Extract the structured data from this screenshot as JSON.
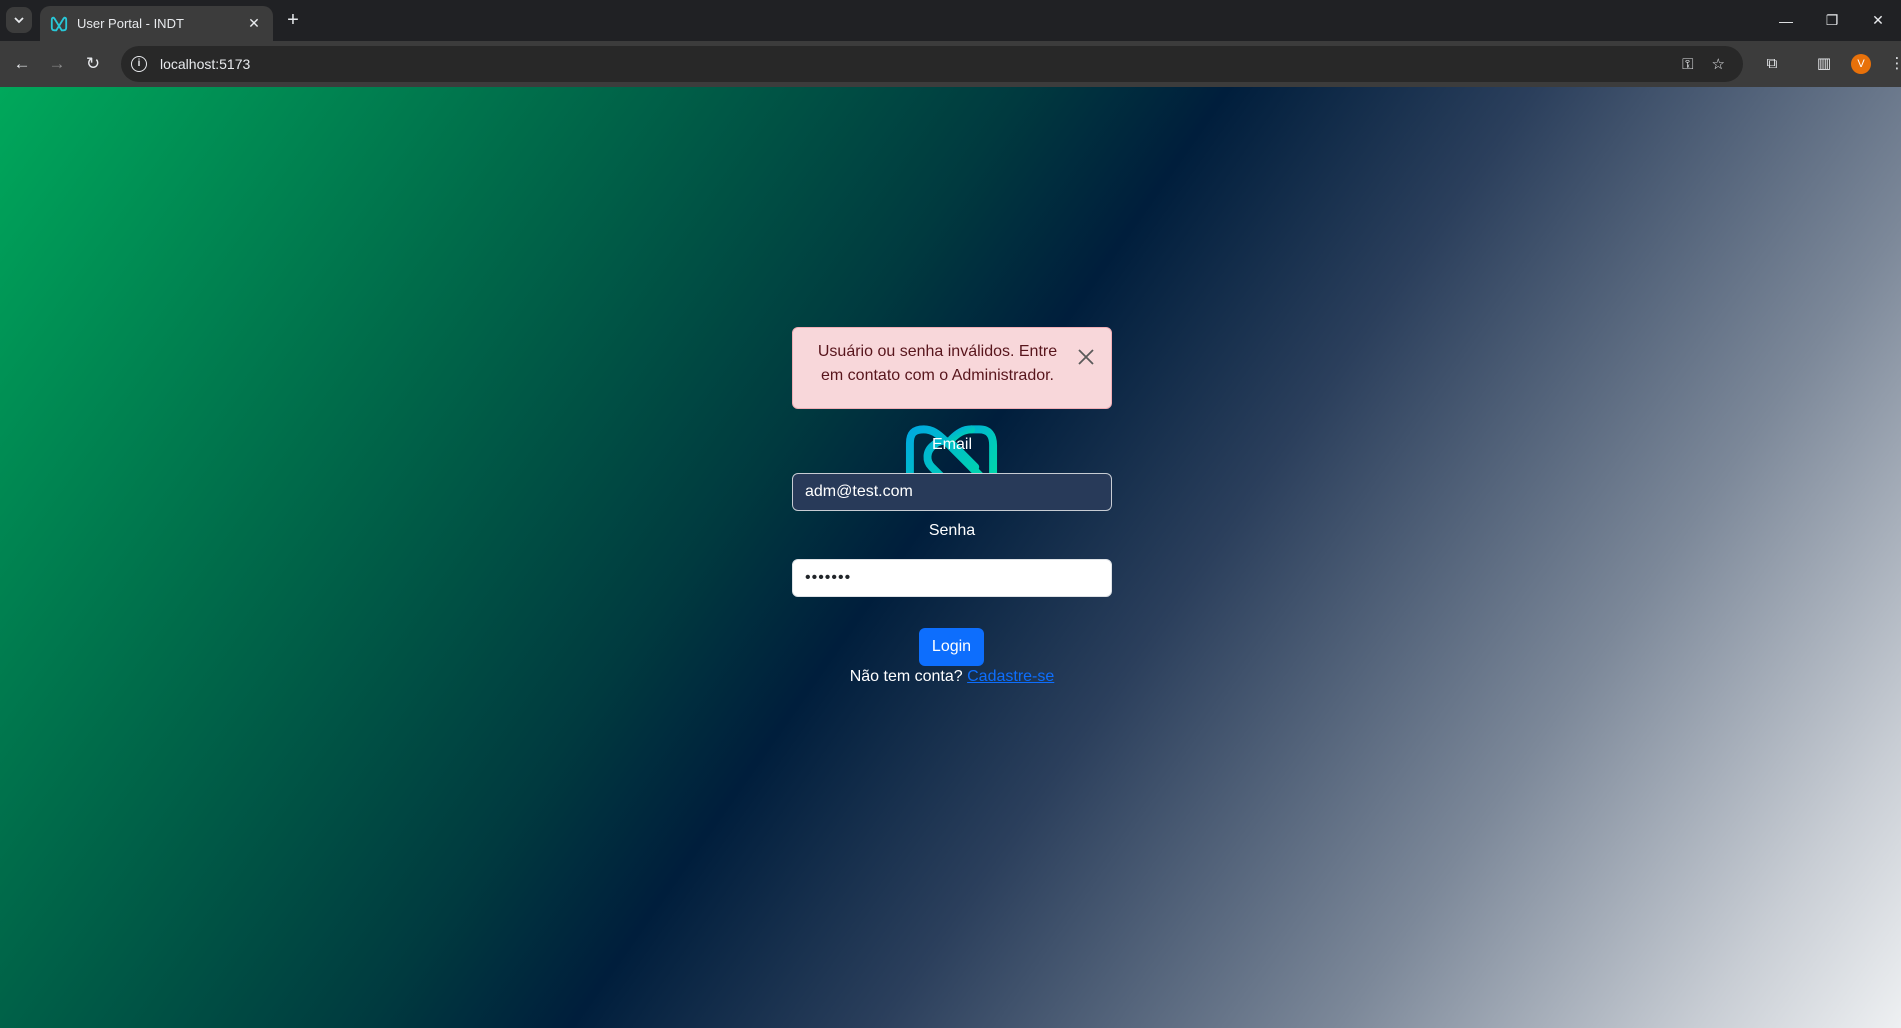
{
  "browser": {
    "tab_title": "User Portal - INDT",
    "url": "localhost:5173",
    "profile_initial": "V"
  },
  "alert": {
    "message": "Usuário ou senha inválidos. Entre em contato com o Administrador."
  },
  "form": {
    "email_label": "Email",
    "email_value": "adm@test.com",
    "password_label": "Senha",
    "password_value": "•••••••",
    "login_label": "Login",
    "signup_prompt": "Não tem conta?",
    "signup_link": "Cadastre-se"
  },
  "colors": {
    "accent": "#0d6efd",
    "alert_bg": "#f8d7da",
    "logo_start": "#00a9e0",
    "logo_end": "#00e0a0"
  }
}
